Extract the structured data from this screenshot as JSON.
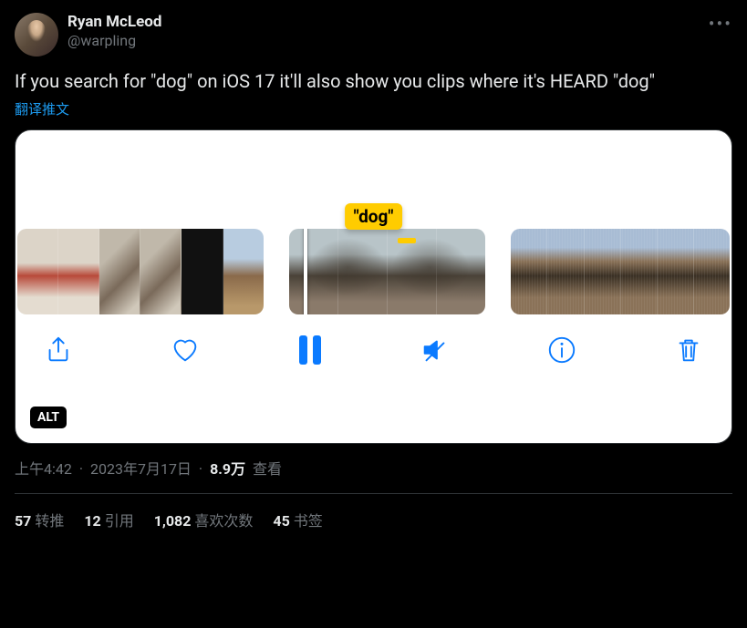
{
  "author": {
    "display_name": "Ryan McLeod",
    "handle": "@warpling"
  },
  "tweet_text": "If you search for \"dog\" on iOS 17 it'll also show you clips where it's HEARD \"dog\"",
  "translate_label": "翻译推文",
  "search_pill": "\"dog\"",
  "alt_badge": "ALT",
  "meta": {
    "time": "上午4:42",
    "date": "2023年7月17日",
    "views_count": "8.9万",
    "views_label": "查看"
  },
  "stats": {
    "retweets_count": "57",
    "retweets_label": "转推",
    "quotes_count": "12",
    "quotes_label": "引用",
    "likes_count": "1,082",
    "likes_label": "喜欢次数",
    "bookmarks_count": "45",
    "bookmarks_label": "书签"
  },
  "toolbar": {
    "share": "share",
    "like": "like",
    "pause": "pause",
    "mute": "mute",
    "info": "info",
    "trash": "trash"
  }
}
